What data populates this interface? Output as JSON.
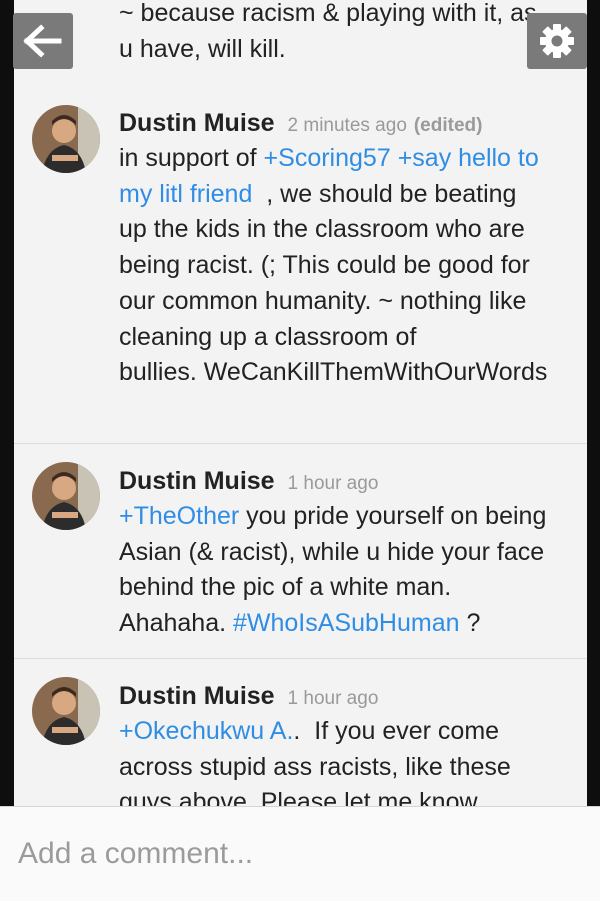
{
  "top_comment": {
    "line1": "~ because racism & playing with it, as",
    "line2": "u have, will kill."
  },
  "comments": [
    {
      "author": "Dustin Muise",
      "time": "2 minutes ago",
      "edited": "(edited)",
      "mention1": "+Scoring57",
      "mention2": "+say hello to",
      "mention2b": "my litl friend",
      "line2_rest": "  , we should be beating",
      "line3": "up the kids in the classroom who are",
      "line4": "being racist.  (; This could be good for",
      "line5": "our common humanity.  ~ nothing like",
      "line6": "cleaning up a classroom of",
      "line7": "bullies. WeCanKillThemWithOurWords",
      "prefix": "in support of"
    },
    {
      "author": "Dustin Muise",
      "time": "1 hour ago",
      "mention": "+TheOther",
      "line1_rest": " you pride yourself on being",
      "line2": "Asian (& racist), while u hide your face",
      "line3": "behind the pic of a white man.",
      "line4_pre": "Ahahaha. ",
      "hashtag": "#WhoIsASubHuman",
      "line4_post": " ?"
    },
    {
      "author": "Dustin Muise",
      "time": "1 hour ago",
      "mention": "+Okechukwu A.",
      "line1_rest": ".  If you ever come",
      "line2": "across stupid ass racists, like these",
      "line3": "guys above. Please let me know."
    }
  ],
  "comment_box": {
    "placeholder": "Add a comment..."
  },
  "icons": {
    "back": "back-arrow-icon",
    "settings": "gear-icon"
  },
  "colors": {
    "link": "#2f8de4",
    "name": "#222222",
    "meta": "#9a9a9a",
    "button": "#7a7a7a"
  }
}
